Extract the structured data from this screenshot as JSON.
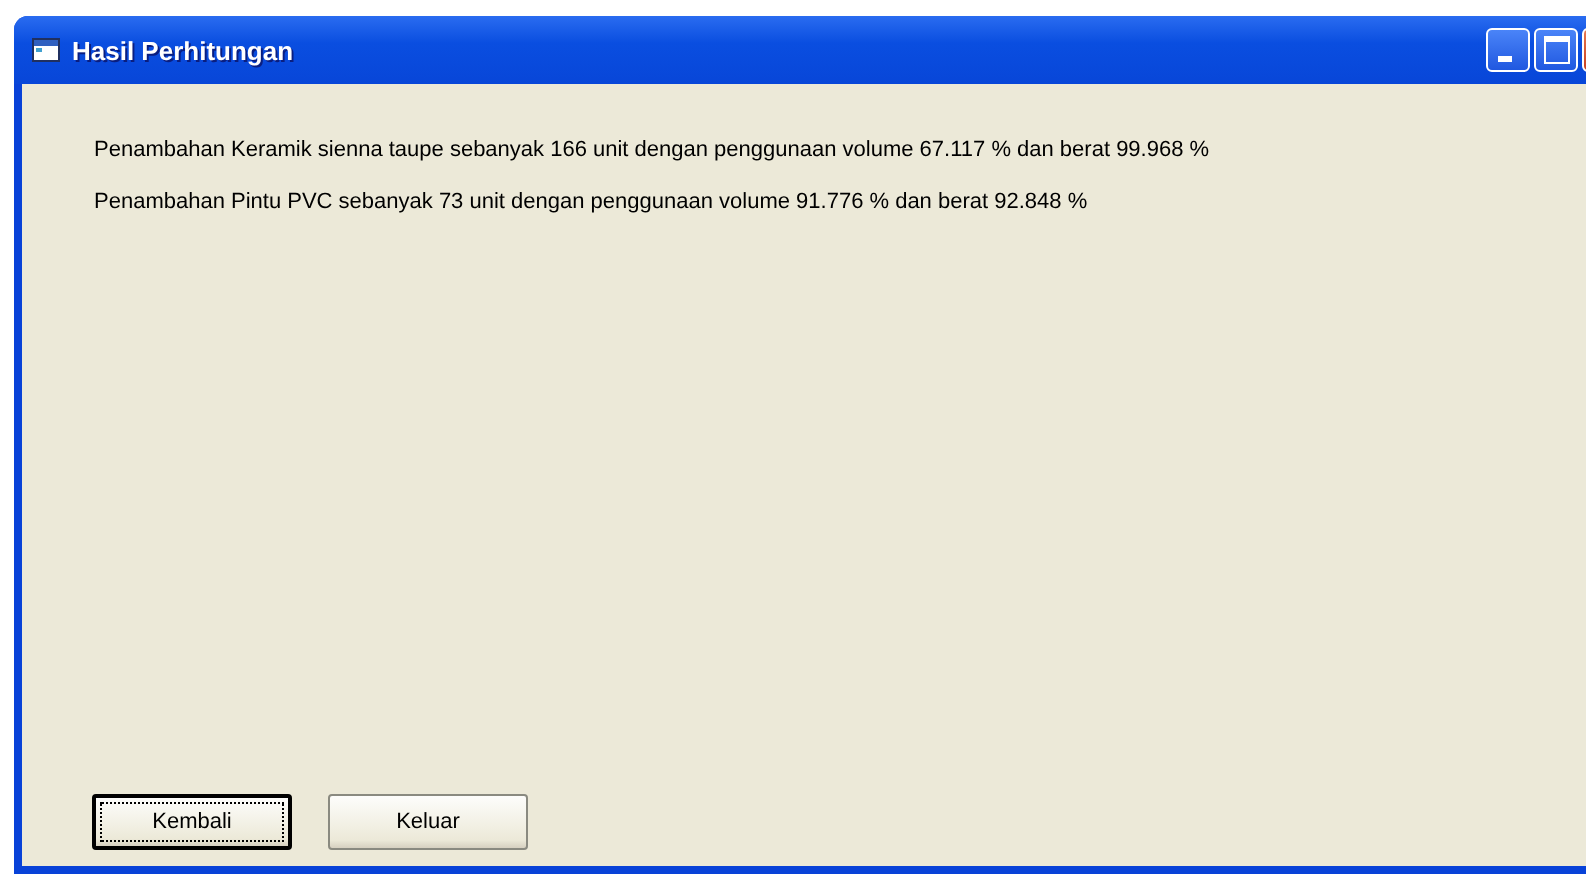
{
  "window": {
    "title": "Hasil Perhitungan"
  },
  "lines": [
    "Penambahan Keramik sienna taupe sebanyak 166 unit dengan penggunaan volume 67.117 % dan berat 99.968 %",
    "Penambahan Pintu PVC sebanyak 73 unit dengan penggunaan volume 91.776 % dan berat 92.848 %"
  ],
  "buttons": [
    {
      "label": "Kembali",
      "focused": true
    },
    {
      "label": "Keluar",
      "focused": false
    }
  ]
}
